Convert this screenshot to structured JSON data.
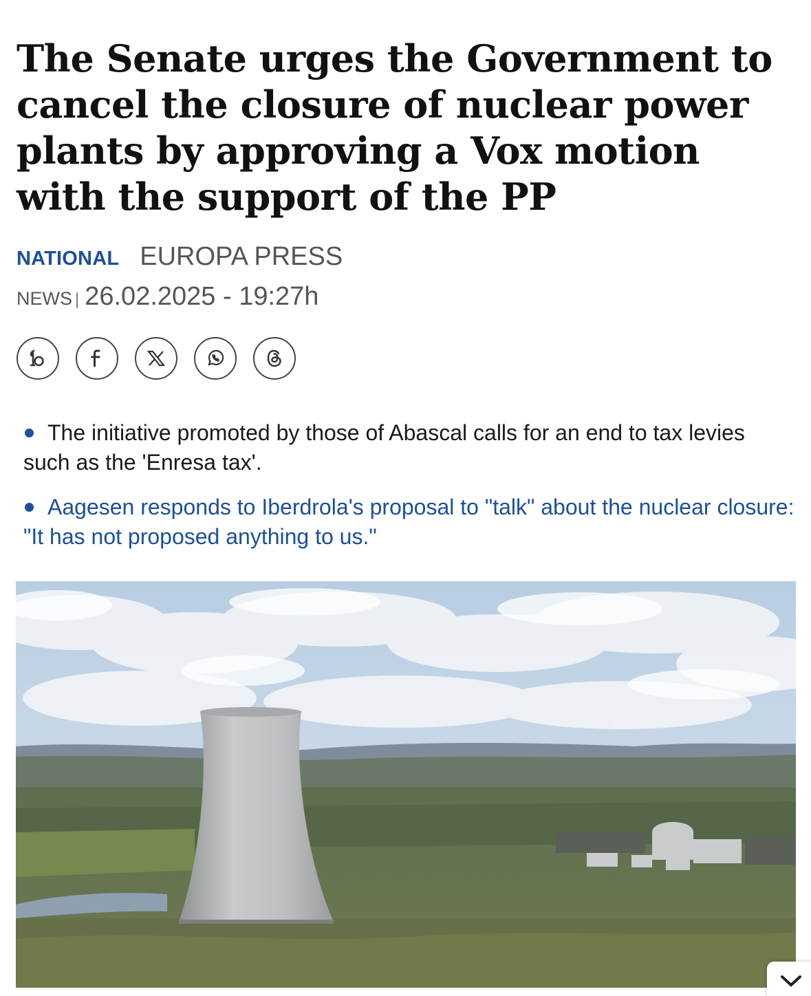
{
  "article": {
    "headline": "The Senate urges the Government to cancel the closure of nuclear power plants by approving a Vox motion with the support of the PP",
    "section": "NATIONAL",
    "source": "EUROPA PRESS",
    "type": "NEWS",
    "separator": "|",
    "datetime": "26.02.2025 - 19:27h"
  },
  "share": {
    "icons": [
      "bluesky-icon",
      "facebook-icon",
      "x-icon",
      "whatsapp-icon",
      "threads-icon"
    ]
  },
  "bullets": [
    {
      "text": "The initiative promoted by those of Abascal calls for an end to tax levies such as the 'Enresa tax'.",
      "is_link": false
    },
    {
      "text": "Aagesen responds to Iberdrola's proposal to \"talk\" about the nuclear closure: \"It has not proposed anything to us.\"",
      "is_link": true
    }
  ],
  "colors": {
    "accent": "#1c4f9c",
    "text": "#111111",
    "meta": "#555555"
  }
}
